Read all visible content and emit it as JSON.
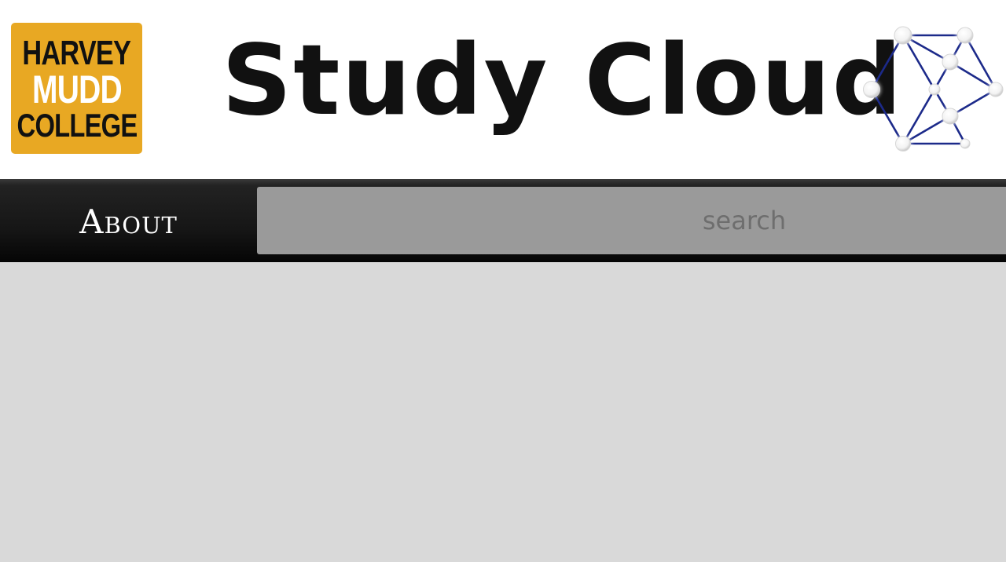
{
  "header": {
    "college_logo": {
      "lines": [
        "HARVEY",
        "MUDD",
        "COLLEGE"
      ],
      "colors": {
        "background": "#e8a823",
        "dark": "#111111",
        "light": "#ffffff"
      }
    },
    "title": "Study Cloud",
    "network_logo": {
      "icon": "network-graph-icon",
      "color": "#1a237e"
    }
  },
  "nav": {
    "about_label": "About",
    "search": {
      "placeholder": "search",
      "value": ""
    }
  }
}
